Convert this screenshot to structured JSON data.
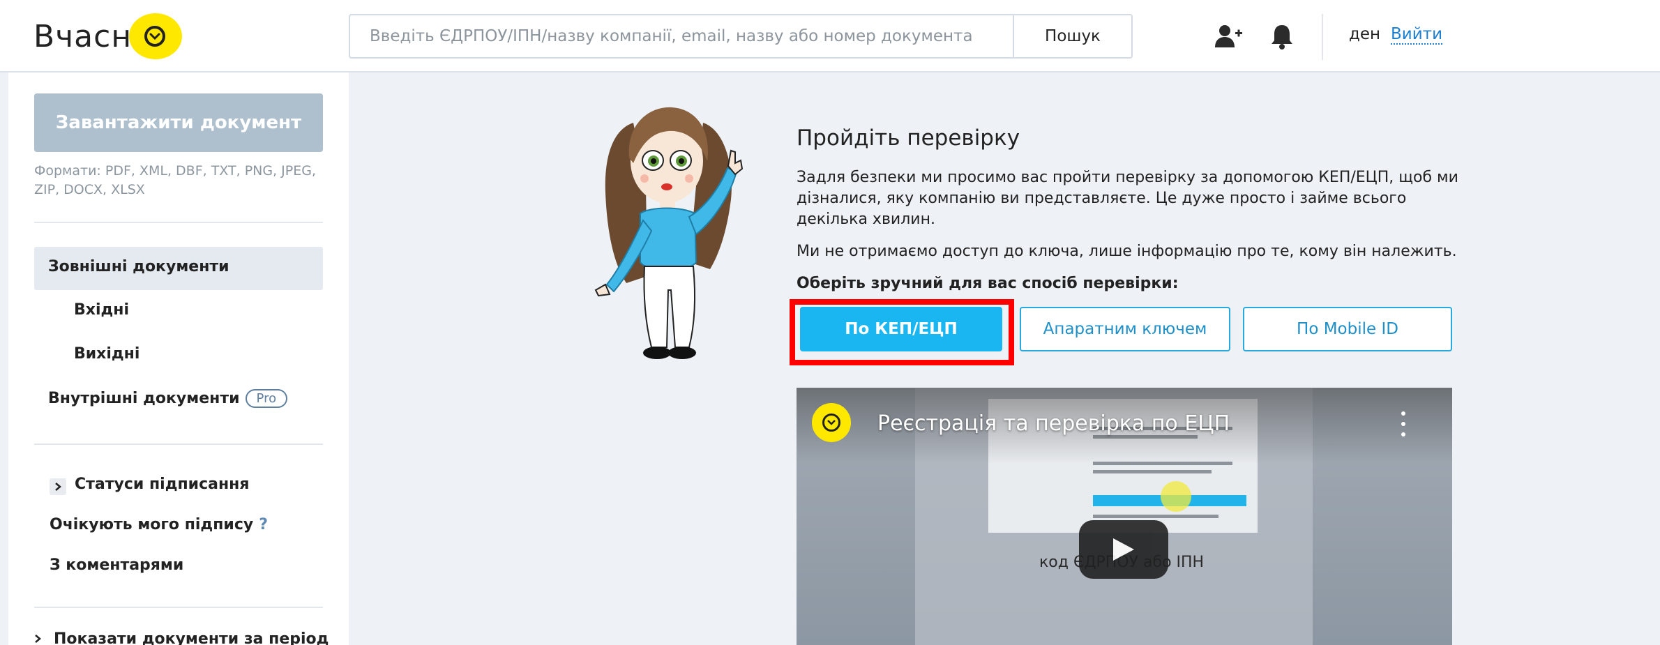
{
  "header": {
    "logo_text": "Вчасн",
    "search_placeholder": "Введіть ЄДРПОУ/ІПН/назву компанії, email, назву або номер документа",
    "search_button": "Пошук",
    "user_name": "ден",
    "logout": "Вийти",
    "icons": [
      "add-user-icon",
      "bell-icon"
    ]
  },
  "sidebar": {
    "upload_button": "Завантажити документ",
    "formats": "Формати: PDF, XML, DBF, TXT, PNG, JPEG, ZIP, DOCX, XLSX",
    "items": [
      {
        "label": "Зовнішні документи"
      },
      {
        "label": "Вхідні"
      },
      {
        "label": "Вихідні"
      },
      {
        "label": "Внутрішні документи",
        "badge": "Pro"
      },
      {
        "label": "Статуси підписання"
      },
      {
        "label": "Очікують мого підпису",
        "hint": "?"
      },
      {
        "label": "З коментарями"
      },
      {
        "label": "Показати документи за період"
      }
    ]
  },
  "main": {
    "title": "Пройдіть перевірку",
    "paragraph1": "Задля безпеки ми просимо вас пройти перевірку за допомогою КЕП/ЕЦП, щоб ми дізналися, яку компанію ви представляєте. Це дуже просто і займе всього декілька хвилин.",
    "paragraph2": "Ми не отримаємо доступ до ключа, лише інформацію про те, кому він належить.",
    "choose_label": "Оберіть зручний для вас спосіб перевірки:",
    "buttons": {
      "kep": "По КЕП/ЕЦП",
      "hardware": "Апаратним ключем",
      "mobile_id": "По Mobile ID"
    },
    "video": {
      "title": "Реєстрація та перевірка по ЕЦП",
      "caption": "код ЄДРПОУ або ІПН"
    }
  },
  "colors": {
    "accent": "#19b6f2",
    "brand_yellow": "#ffe800",
    "link": "#1d7fd0",
    "highlight": "#ff0000"
  }
}
